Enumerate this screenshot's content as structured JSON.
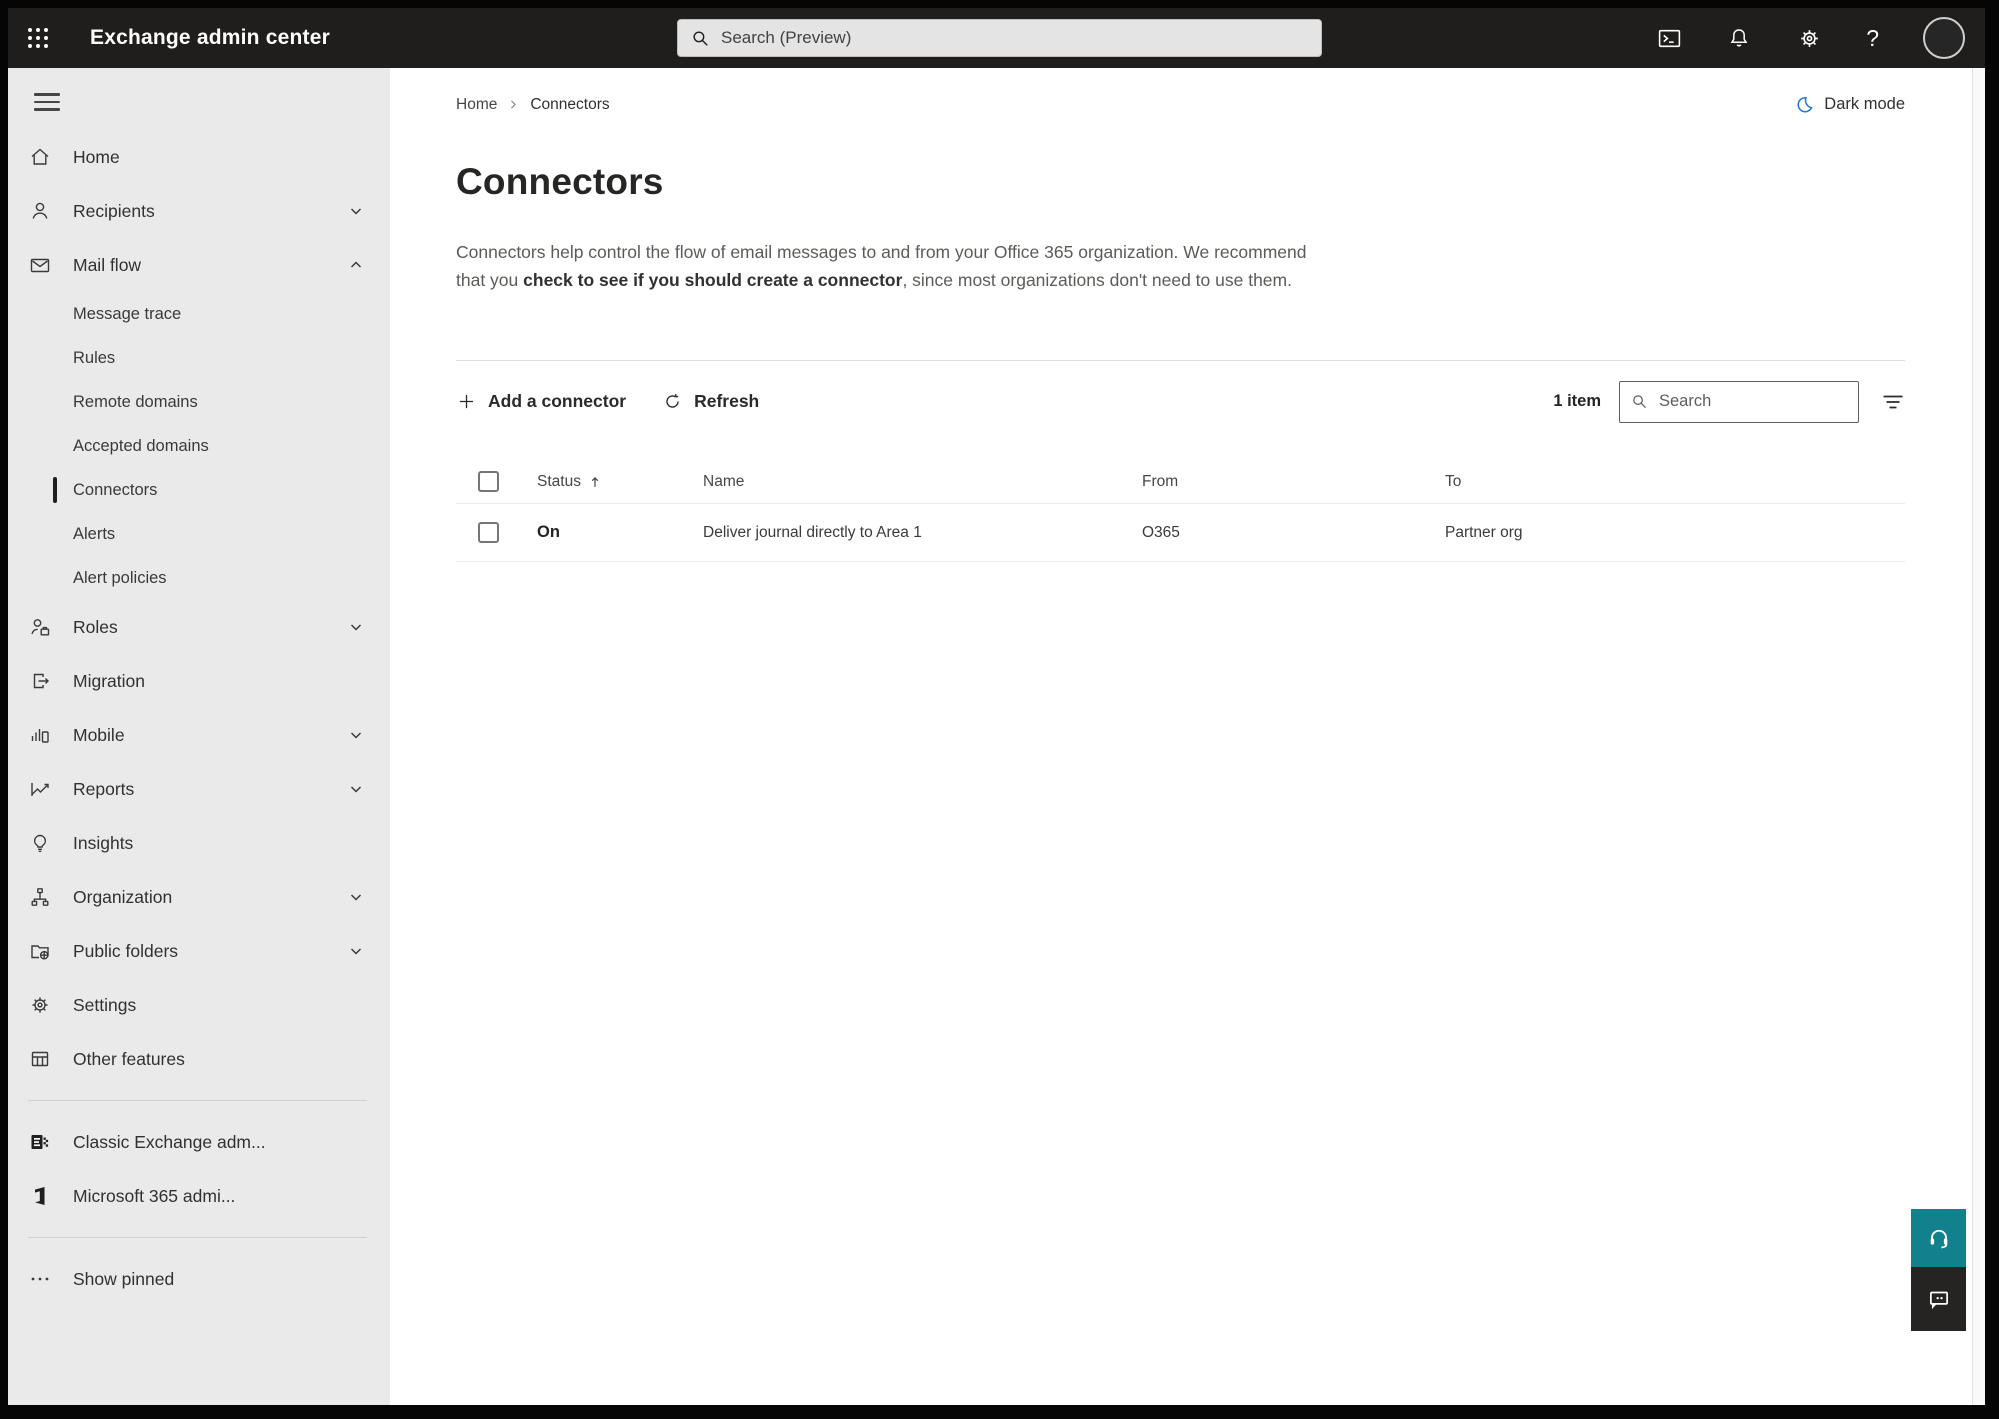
{
  "topbar": {
    "title": "Exchange admin center",
    "search_placeholder": "Search (Preview)"
  },
  "icons": {
    "help_glyph": "?",
    "names": [
      "app-launcher-icon",
      "search-icon",
      "terminal-icon",
      "bell-icon",
      "gear-icon",
      "help-icon",
      "avatar",
      "moon-icon",
      "plus-icon",
      "refresh-icon",
      "filter-icon",
      "sort-up-icon",
      "headset-icon",
      "feedback-icon"
    ]
  },
  "sidebar": {
    "items": [
      {
        "label": "Home"
      },
      {
        "label": "Recipients"
      },
      {
        "label": "Mail flow"
      },
      {
        "label": "Message trace"
      },
      {
        "label": "Rules"
      },
      {
        "label": "Remote domains"
      },
      {
        "label": "Accepted domains"
      },
      {
        "label": "Connectors"
      },
      {
        "label": "Alerts"
      },
      {
        "label": "Alert policies"
      },
      {
        "label": "Roles"
      },
      {
        "label": "Migration"
      },
      {
        "label": "Mobile"
      },
      {
        "label": "Reports"
      },
      {
        "label": "Insights"
      },
      {
        "label": "Organization"
      },
      {
        "label": "Public folders"
      },
      {
        "label": "Settings"
      },
      {
        "label": "Other features"
      },
      {
        "label": "Classic Exchange adm..."
      },
      {
        "label": "Microsoft 365 admi..."
      },
      {
        "label": "Show pinned"
      }
    ]
  },
  "breadcrumb": {
    "home": "Home",
    "current": "Connectors"
  },
  "dark_mode_label": "Dark mode",
  "page": {
    "title": "Connectors",
    "description_part1": "Connectors help control the flow of email messages to and from your Office 365 organization. We recommend that you ",
    "description_link": "check to see if you should create a connector",
    "description_part2": ", since most organizations don't need to use them."
  },
  "toolbar": {
    "add_label": "Add a connector",
    "refresh_label": "Refresh",
    "item_count": "1 item",
    "search_placeholder": "Search"
  },
  "table": {
    "headers": {
      "status": "Status",
      "name": "Name",
      "from": "From",
      "to": "To"
    },
    "rows": [
      {
        "status": "On",
        "name": "Deliver journal directly to Area 1",
        "from": "O365",
        "to": "Partner org"
      }
    ]
  },
  "colors": {
    "accent_teal": "#12808d",
    "moon_blue": "#2477d4",
    "topbar_bg": "#1f1e1d",
    "sidebar_bg": "#eaeaea"
  }
}
